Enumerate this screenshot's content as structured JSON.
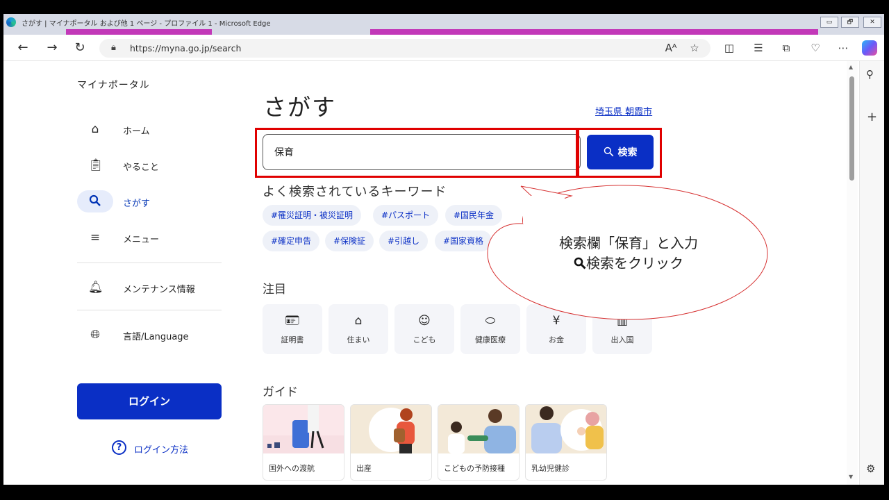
{
  "window": {
    "title": "さがす | マイナポータル および他 1 ページ - プロファイル 1 - Microsoft Edge",
    "controls": [
      "▭",
      "🗗",
      "✕"
    ]
  },
  "browser": {
    "url": "https://myna.go.jp/search"
  },
  "sidebar": {
    "brand": "マイナポータル",
    "items": [
      {
        "label": "ホーム",
        "icon": "home-icon"
      },
      {
        "label": "やること",
        "icon": "clipboard-icon"
      },
      {
        "label": "さがす",
        "icon": "search-icon",
        "active": true
      },
      {
        "label": "メニュー",
        "icon": "menu-icon"
      },
      {
        "label": "メンテナンス情報",
        "icon": "bell-icon"
      },
      {
        "label": "言語/Language",
        "icon": "globe-icon"
      }
    ],
    "login_label": "ログイン",
    "login_help": "ログイン方法"
  },
  "main": {
    "title": "さがす",
    "region": "埼玉県 朝霞市",
    "search": {
      "value": "保育",
      "button_label": "検索"
    },
    "keywords_title": "よく検索されているキーワード",
    "keywords": [
      "#罹災証明・被災証明",
      "#パスポート",
      "#国民年金",
      "#確定申告",
      "#保険証",
      "#引越し",
      "#国家資格"
    ],
    "attention_title": "注目",
    "attention_tiles": [
      {
        "label": "証明書",
        "icon": "id-card-icon"
      },
      {
        "label": "住まい",
        "icon": "house-icon"
      },
      {
        "label": "こども",
        "icon": "child-face-icon"
      },
      {
        "label": "健康医療",
        "icon": "pill-icon"
      },
      {
        "label": "お金",
        "icon": "yen-icon"
      },
      {
        "label": "出入国",
        "icon": "luggage-icon"
      }
    ],
    "guide_title": "ガイド",
    "guides": [
      {
        "label": "国外への渡航"
      },
      {
        "label": "出産"
      },
      {
        "label": "こどもの予防接種"
      },
      {
        "label": "乳幼児健診"
      }
    ]
  },
  "callout": {
    "line1": "検索欄「保育」と入力",
    "line2": "検索をクリック"
  },
  "colors": {
    "primary": "#0a2fc5",
    "annotation_red": "#e00000",
    "tab_accent": "#c238b8"
  }
}
